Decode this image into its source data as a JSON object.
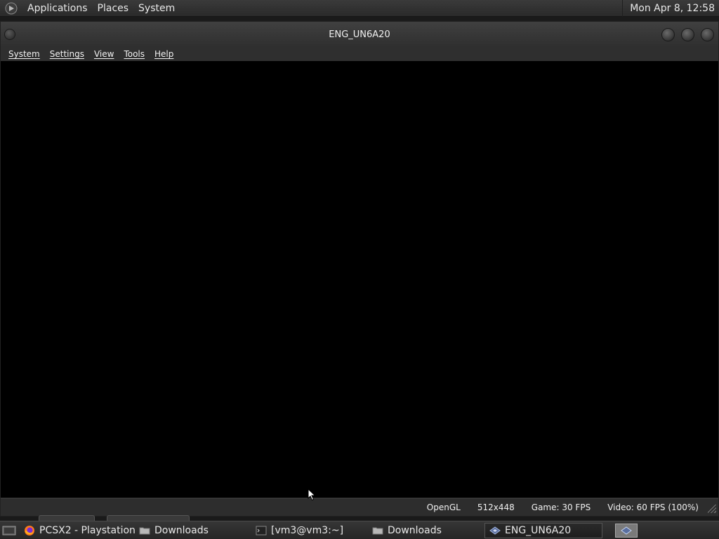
{
  "top_panel": {
    "menus": [
      "Applications",
      "Places",
      "System"
    ],
    "clock": "Mon Apr  8, 12:58"
  },
  "window": {
    "title": "ENG_UN6A20",
    "menu": [
      "System",
      "Settings",
      "View",
      "Tools",
      "Help"
    ],
    "status": {
      "renderer": "OpenGL",
      "resolution": "512x448",
      "game_fps": "Game: 30 FPS",
      "video_fps": "Video: 60 FPS (100%)"
    }
  },
  "taskbar": {
    "tasks": [
      {
        "label": "PCSX2 - Playstation ...",
        "icon": "firefox-icon"
      },
      {
        "label": "Downloads",
        "icon": "folder-icon"
      },
      {
        "label": "[vm3@vm3:~]",
        "icon": "terminal-icon"
      },
      {
        "label": "Downloads",
        "icon": "folder-icon"
      },
      {
        "label": "ENG_UN6A20",
        "icon": "pcsx2-icon"
      }
    ]
  },
  "colors": {
    "viewport": "#000000",
    "panel": "#2e2e2e",
    "text": "#e8e8e8"
  }
}
